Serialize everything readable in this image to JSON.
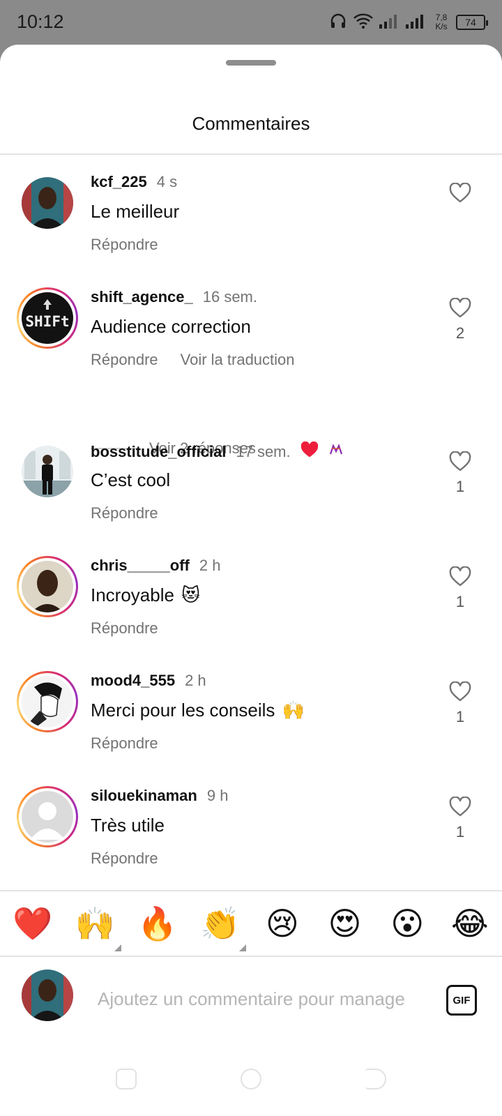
{
  "status_bar": {
    "time": "10:12",
    "net_speed_value": "7,8",
    "net_speed_unit": "K/s",
    "battery": "74"
  },
  "sheet": {
    "title": "Commentaires"
  },
  "comments": [
    {
      "username": "kcf_225",
      "time": "4 s",
      "text": "Le meilleur",
      "emoji": "",
      "reply_label": "Répondre",
      "translate_label": "",
      "likes": "",
      "ring": "none"
    },
    {
      "username": "shift_agence_",
      "time": "16 sem.",
      "text": "Audience correction",
      "emoji": "",
      "reply_label": "Répondre",
      "translate_label": "Voir la traduction",
      "likes": "2",
      "ring": "gradient"
    },
    {
      "username": "bosstitude_official",
      "time": "17 sem.",
      "text": "C’est cool",
      "emoji": "",
      "reply_label": "Répondre",
      "translate_label": "",
      "likes": "1",
      "ring": "none"
    },
    {
      "username": "chris_____off",
      "time": "2 h",
      "text": "Incroyable",
      "emoji": "😻",
      "reply_label": "Répondre",
      "translate_label": "",
      "likes": "1",
      "ring": "gradient"
    },
    {
      "username": "mood4_555",
      "time": "2 h",
      "text": "Merci pour les conseils",
      "emoji": "🙌",
      "reply_label": "Répondre",
      "translate_label": "",
      "likes": "1",
      "ring": "gradient"
    },
    {
      "username": "silouekinaman",
      "time": "9 h",
      "text": "Très utile",
      "emoji": "",
      "reply_label": "Répondre",
      "translate_label": "",
      "likes": "1",
      "ring": "gradient"
    }
  ],
  "replies_toggle": {
    "label": "Voir 2 réponses"
  },
  "avatar_art": {
    "shift_logo_text": "SHIFt"
  },
  "emoji_bar": [
    "❤️",
    "🙌",
    "🔥",
    "👏",
    "😢",
    "😍",
    "😮",
    "😂"
  ],
  "composer": {
    "placeholder": "Ajoutez un commentaire pour manage",
    "gif_label": "GIF"
  },
  "icons": {
    "like": "heart-outline-icon",
    "liked_by_author": "red-heart-icon"
  },
  "colors": {
    "ring_gradient": [
      "#f58529",
      "#feda75",
      "#d62976",
      "#962fbf"
    ],
    "secondary_text": "#737373",
    "red_heart": "#ed1e3c"
  }
}
